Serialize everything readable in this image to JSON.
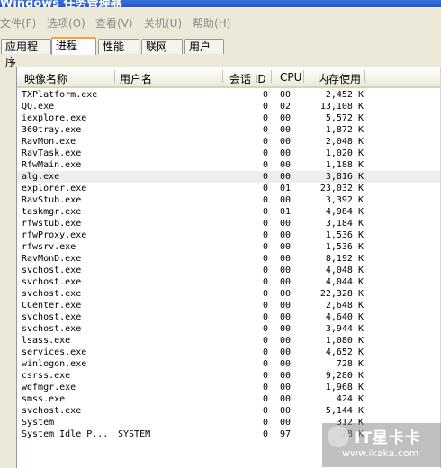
{
  "window": {
    "title": "Windows 任务管理器"
  },
  "menu": [
    "文件(F)",
    "选项(O)",
    "查看(V)",
    "关机(U)",
    "帮助(H)"
  ],
  "tabs": [
    "应用程序",
    "进程",
    "性能",
    "联网",
    "用户"
  ],
  "active_tab": "进程",
  "columns": {
    "name": "映像名称",
    "user": "用户名",
    "session": "会话 ID",
    "cpu": "CPU",
    "mem": "内存使用"
  },
  "processes": [
    {
      "name": "TXPlatform.exe",
      "user": "",
      "session": "0",
      "cpu": "00",
      "mem": "2,452 K"
    },
    {
      "name": "QQ.exe",
      "user": "",
      "session": "0",
      "cpu": "02",
      "mem": "13,108 K"
    },
    {
      "name": "iexplore.exe",
      "user": "",
      "session": "0",
      "cpu": "00",
      "mem": "5,572 K"
    },
    {
      "name": "360tray.exe",
      "user": "",
      "session": "0",
      "cpu": "00",
      "mem": "1,872 K"
    },
    {
      "name": "RavMon.exe",
      "user": "",
      "session": "0",
      "cpu": "00",
      "mem": "2,048 K"
    },
    {
      "name": "RavTask.exe",
      "user": "",
      "session": "0",
      "cpu": "00",
      "mem": "1,020 K"
    },
    {
      "name": "RfwMain.exe",
      "user": "",
      "session": "0",
      "cpu": "00",
      "mem": "1,188 K"
    },
    {
      "name": "alg.exe",
      "user": "",
      "session": "0",
      "cpu": "00",
      "mem": "3,816 K"
    },
    {
      "name": "explorer.exe",
      "user": "",
      "session": "0",
      "cpu": "01",
      "mem": "23,032 K"
    },
    {
      "name": "RavStub.exe",
      "user": "",
      "session": "0",
      "cpu": "00",
      "mem": "3,392 K"
    },
    {
      "name": "taskmgr.exe",
      "user": "",
      "session": "0",
      "cpu": "01",
      "mem": "4,984 K"
    },
    {
      "name": "rfwstub.exe",
      "user": "",
      "session": "0",
      "cpu": "00",
      "mem": "3,184 K"
    },
    {
      "name": "rfwProxy.exe",
      "user": "",
      "session": "0",
      "cpu": "00",
      "mem": "1,536 K"
    },
    {
      "name": "rfwsrv.exe",
      "user": "",
      "session": "0",
      "cpu": "00",
      "mem": "1,536 K"
    },
    {
      "name": "RavMonD.exe",
      "user": "",
      "session": "0",
      "cpu": "00",
      "mem": "8,192 K"
    },
    {
      "name": "svchost.exe",
      "user": "",
      "session": "0",
      "cpu": "00",
      "mem": "4,048 K"
    },
    {
      "name": "svchost.exe",
      "user": "",
      "session": "0",
      "cpu": "00",
      "mem": "4,044 K"
    },
    {
      "name": "svchost.exe",
      "user": "",
      "session": "0",
      "cpu": "00",
      "mem": "22,328 K"
    },
    {
      "name": "CCenter.exe",
      "user": "",
      "session": "0",
      "cpu": "00",
      "mem": "2,648 K"
    },
    {
      "name": "svchost.exe",
      "user": "",
      "session": "0",
      "cpu": "00",
      "mem": "4,640 K"
    },
    {
      "name": "svchost.exe",
      "user": "",
      "session": "0",
      "cpu": "00",
      "mem": "3,944 K"
    },
    {
      "name": "lsass.exe",
      "user": "",
      "session": "0",
      "cpu": "00",
      "mem": "1,080 K"
    },
    {
      "name": "services.exe",
      "user": "",
      "session": "0",
      "cpu": "00",
      "mem": "4,652 K"
    },
    {
      "name": "winlogon.exe",
      "user": "",
      "session": "0",
      "cpu": "00",
      "mem": "728 K"
    },
    {
      "name": "csrss.exe",
      "user": "",
      "session": "0",
      "cpu": "00",
      "mem": "9,280 K"
    },
    {
      "name": "wdfmgr.exe",
      "user": "",
      "session": "0",
      "cpu": "00",
      "mem": "1,968 K"
    },
    {
      "name": "smss.exe",
      "user": "",
      "session": "0",
      "cpu": "00",
      "mem": "424 K"
    },
    {
      "name": "svchost.exe",
      "user": "",
      "session": "0",
      "cpu": "00",
      "mem": "5,144 K"
    },
    {
      "name": "System",
      "user": "",
      "session": "0",
      "cpu": "00",
      "mem": "312 K"
    },
    {
      "name": "System Idle P...",
      "user": "SYSTEM",
      "session": "0",
      "cpu": "97",
      "mem": "28 K"
    }
  ],
  "selected_index": 7,
  "watermark": {
    "brand": "IT星卡卡",
    "url": "www.ikaka.com"
  }
}
